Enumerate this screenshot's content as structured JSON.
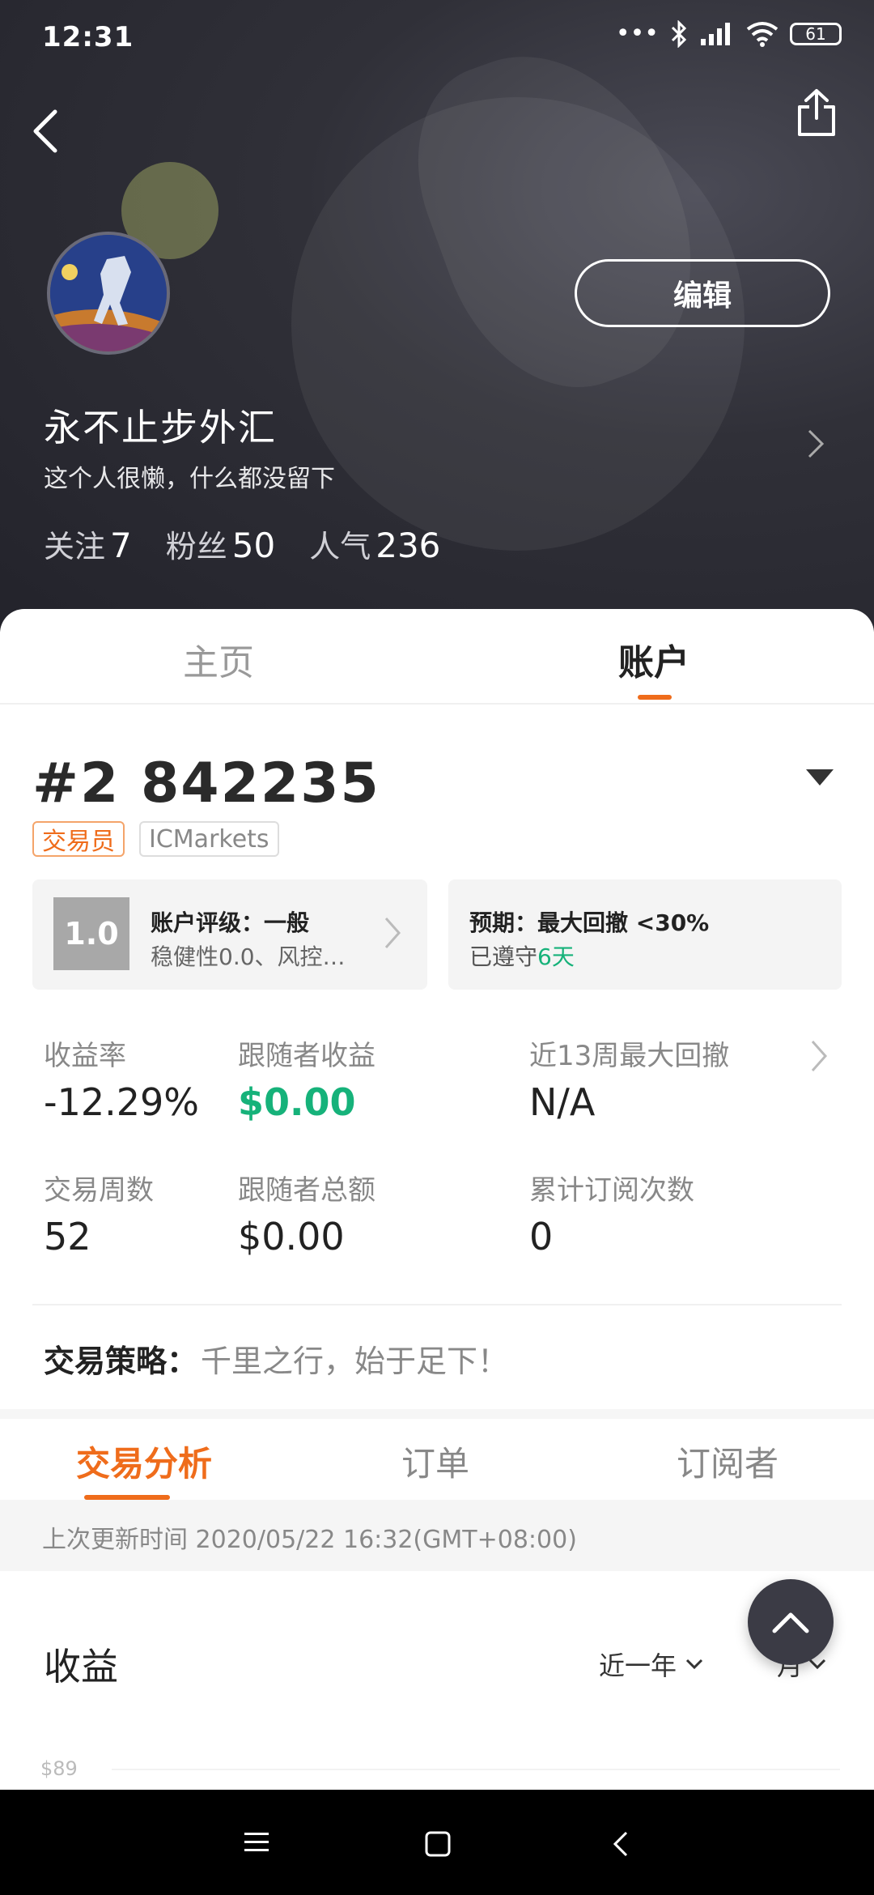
{
  "status_bar": {
    "time": "12:31",
    "battery": "61"
  },
  "profile": {
    "name": "永不止步外汇",
    "bio": "这个人很懒，什么都没留下",
    "edit_label": "编辑",
    "stats": [
      {
        "label": "关注",
        "value": "7"
      },
      {
        "label": "粉丝",
        "value": "50"
      },
      {
        "label": "人气",
        "value": "236"
      }
    ]
  },
  "main_tabs": [
    {
      "label": "主页",
      "active": false
    },
    {
      "label": "账户",
      "active": true
    }
  ],
  "account": {
    "number": "#2 842235",
    "tags": [
      "交易员",
      "ICMarkets"
    ],
    "rating": {
      "score": "1.0",
      "title": "账户评级：一般",
      "detail": "稳健性0.0、风控…"
    },
    "expectation": {
      "title": "预期：最大回撤 <30%",
      "prefix": "已遵守",
      "days": "6天"
    }
  },
  "metrics": [
    {
      "label": "收益率",
      "value": "-12.29%"
    },
    {
      "label": "跟随者收益",
      "value": "$0.00"
    },
    {
      "label": "近13周最大回撤",
      "value": "N/A"
    },
    {
      "label": "交易周数",
      "value": "52"
    },
    {
      "label": "跟随者总额",
      "value": "$0.00"
    },
    {
      "label": "累计订阅次数",
      "value": "0"
    }
  ],
  "strategy": {
    "label": "交易策略：",
    "value": "千里之行，始于足下！"
  },
  "sub_tabs": [
    {
      "label": "交易分析",
      "active": true
    },
    {
      "label": "订单",
      "active": false
    },
    {
      "label": "订阅者",
      "active": false
    }
  ],
  "last_update": "上次更新时间 2020/05/22 16:32(GMT+08:00)",
  "earnings": {
    "title": "收益",
    "period": "近一年",
    "unit": "月",
    "y_tick": "$89"
  },
  "colors": {
    "accent": "#ef6c1b",
    "positive": "#16b27a"
  }
}
